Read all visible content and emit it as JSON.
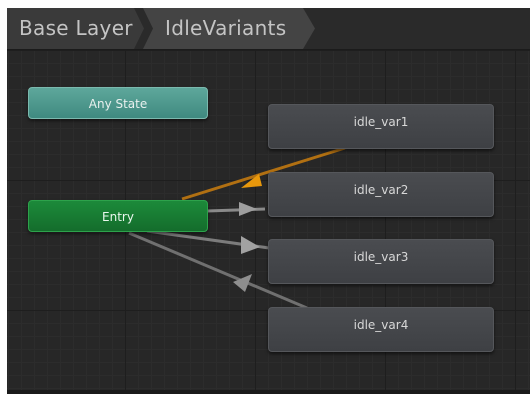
{
  "breadcrumb": {
    "items": [
      "Base Layer",
      "IdleVariants"
    ]
  },
  "graph": {
    "special_nodes": {
      "any_state": "Any State",
      "entry": "Entry"
    },
    "states": [
      "idle_var1",
      "idle_var2",
      "idle_var3",
      "idle_var4"
    ],
    "colors": {
      "any_state": "#4f9a8e",
      "entry": "#188233",
      "state": "#45474b",
      "default_transition": "#f0a016",
      "transition": "#8e8e8e"
    }
  }
}
